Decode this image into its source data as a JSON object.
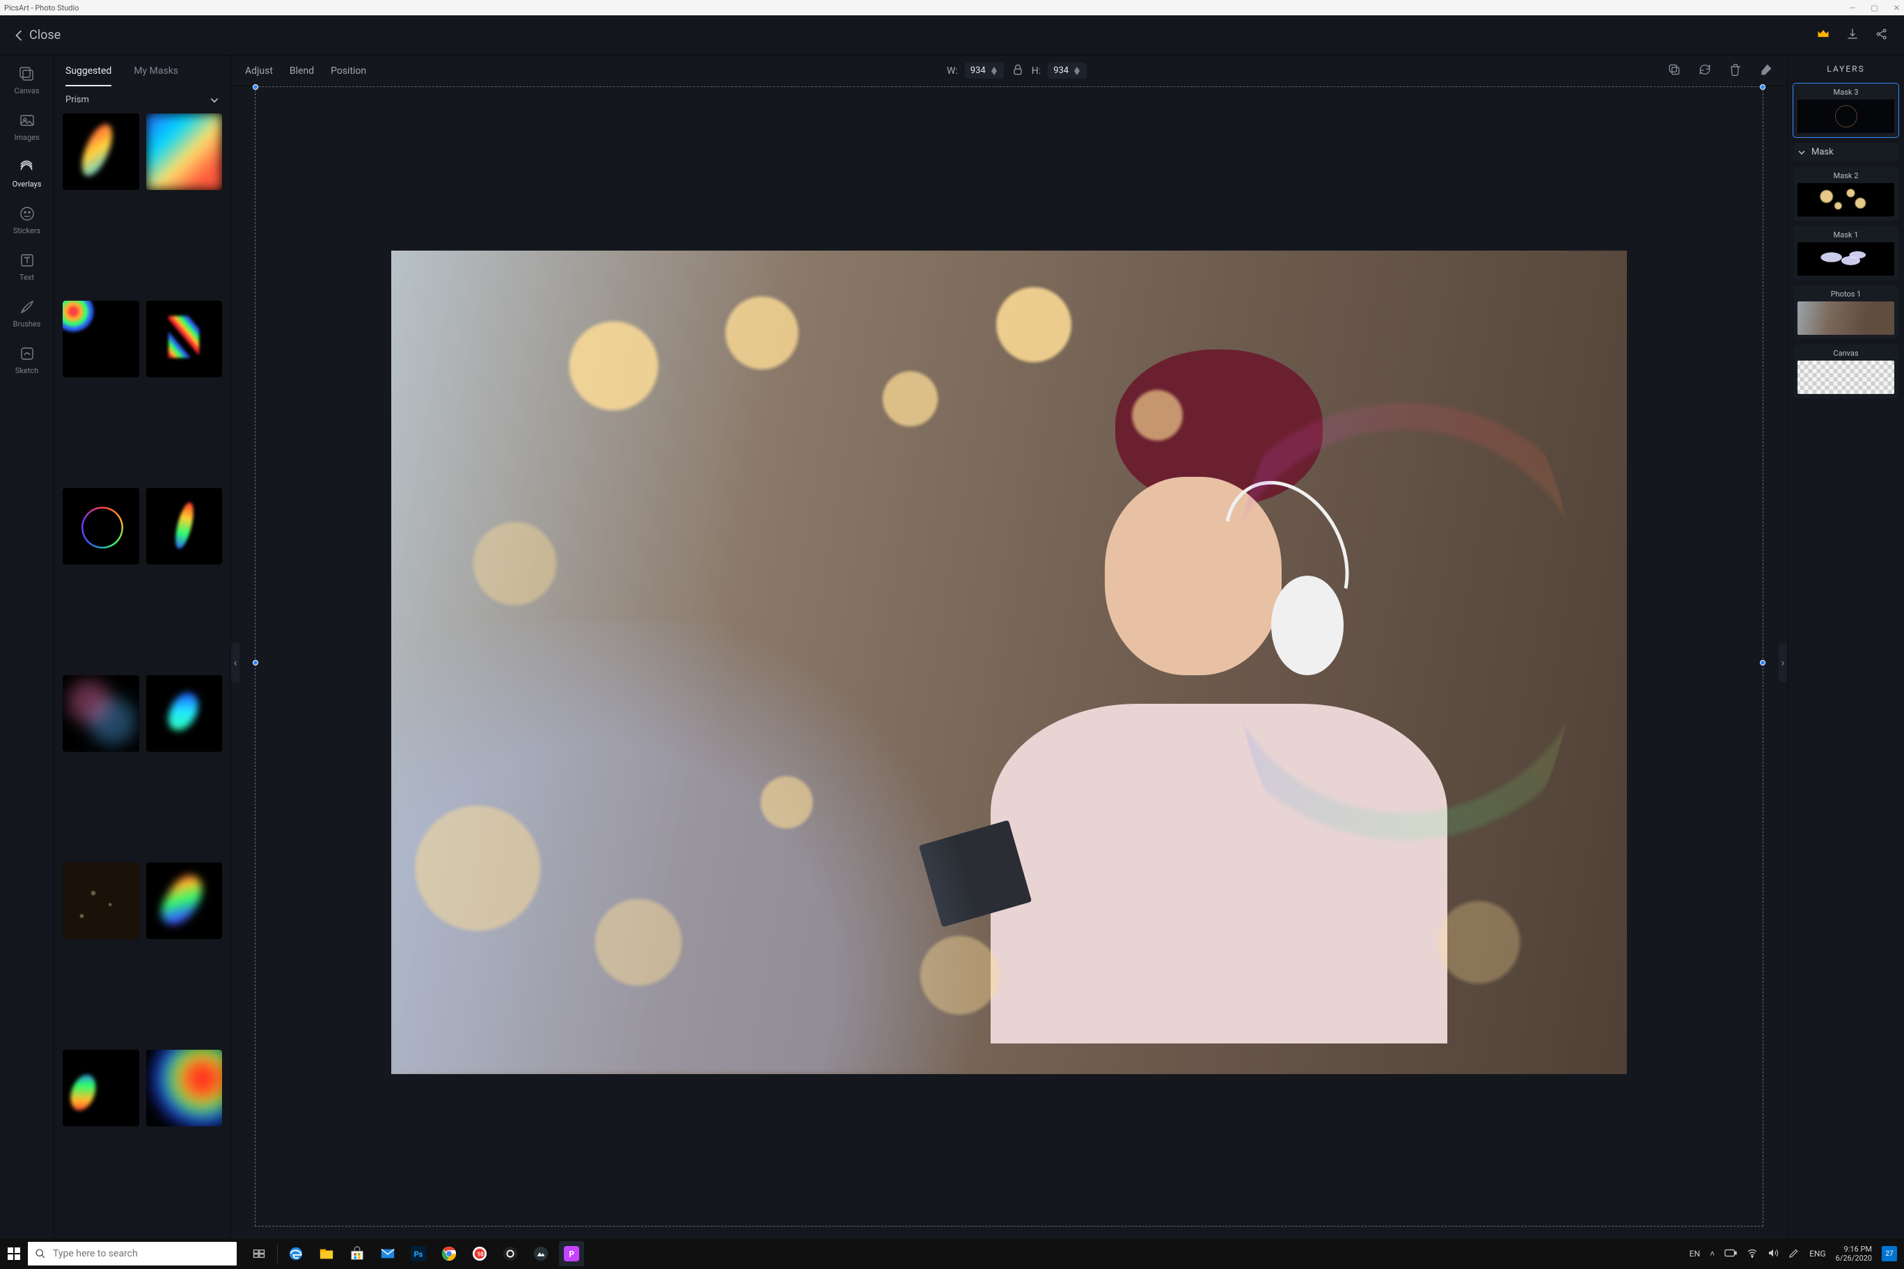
{
  "window": {
    "title": "PicsArt - Photo Studio"
  },
  "topbar": {
    "close": "Close"
  },
  "tools": [
    {
      "id": "canvas",
      "label": "Canvas"
    },
    {
      "id": "images",
      "label": "Images"
    },
    {
      "id": "overlays",
      "label": "Overlays",
      "active": true
    },
    {
      "id": "stickers",
      "label": "Stickers"
    },
    {
      "id": "text",
      "label": "Text"
    },
    {
      "id": "brushes",
      "label": "Brushes"
    },
    {
      "id": "sketch",
      "label": "Sketch"
    }
  ],
  "leftpanel": {
    "tabs": [
      {
        "id": "suggested",
        "label": "Suggested",
        "active": true
      },
      {
        "id": "mymasks",
        "label": "My Masks"
      }
    ],
    "category": "Prism"
  },
  "canvas_toolbar": {
    "tabs": [
      "Adjust",
      "Blend",
      "Position"
    ],
    "w_label": "W:",
    "h_label": "H:",
    "width": "934",
    "height": "934"
  },
  "layers": {
    "title": "LAYERS",
    "mask_section": "Mask",
    "items": [
      {
        "name": "Mask 3",
        "kind": "ring",
        "selected": true
      },
      {
        "name": "Mask 2",
        "kind": "bokeh"
      },
      {
        "name": "Mask 1",
        "kind": "petals"
      },
      {
        "name": "Photos 1",
        "kind": "photo"
      },
      {
        "name": "Canvas",
        "kind": "alpha"
      }
    ]
  },
  "taskbar": {
    "search_placeholder": "Type here to search",
    "lang1": "EN",
    "lang2": "ENG",
    "time": "9:16 PM",
    "date": "6/26/2020",
    "notif_count": "27"
  }
}
